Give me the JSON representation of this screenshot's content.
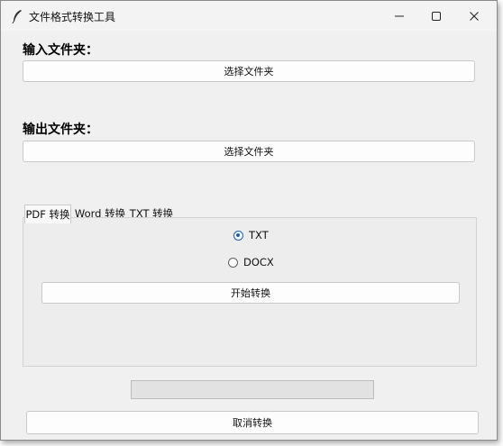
{
  "window": {
    "title": "文件格式转换工具",
    "app_icon": "feather-icon",
    "controls": {
      "minimize": "minimize-icon",
      "maximize": "maximize-icon",
      "close": "close-icon"
    }
  },
  "input_section": {
    "label": "输入文件夹：",
    "button_label": "选择文件夹"
  },
  "output_section": {
    "label": "输出文件夹：",
    "button_label": "选择文件夹"
  },
  "tabs": [
    {
      "label": "PDF 转换",
      "active": true
    },
    {
      "label": "Word 转换",
      "active": false
    },
    {
      "label": "TXT 转换",
      "active": false
    }
  ],
  "pdf_tab": {
    "options": [
      {
        "label": "TXT",
        "selected": true
      },
      {
        "label": "DOCX",
        "selected": false
      }
    ],
    "start_button_label": "开始转换"
  },
  "progress": {
    "value": 0
  },
  "cancel_button_label": "取消转换",
  "colors": {
    "accent": "#1a5fb4",
    "window_bg": "#f0f0f0"
  }
}
